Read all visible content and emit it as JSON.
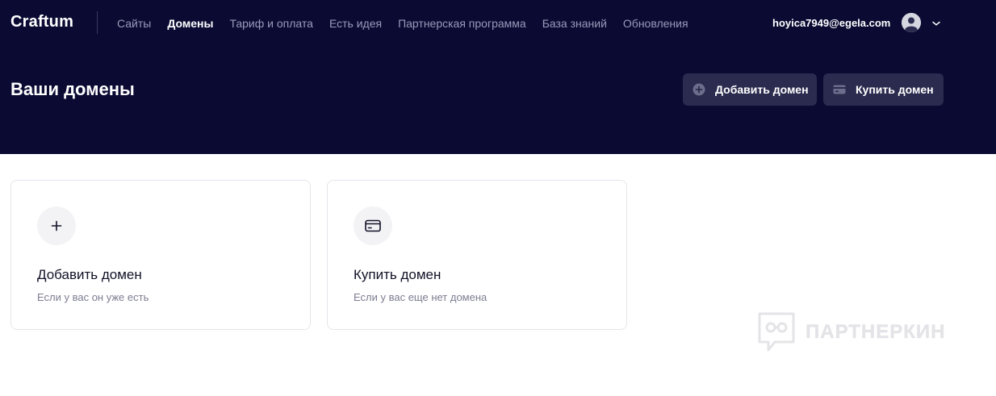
{
  "app": {
    "logo": "Craftum"
  },
  "nav": {
    "items": [
      {
        "label": "Сайты",
        "active": false
      },
      {
        "label": "Домены",
        "active": true
      },
      {
        "label": "Тариф и оплата",
        "active": false
      },
      {
        "label": "Есть идея",
        "active": false
      },
      {
        "label": "Партнерская программа",
        "active": false
      },
      {
        "label": "База знаний",
        "active": false
      },
      {
        "label": "Обновления",
        "active": false
      }
    ]
  },
  "user": {
    "email": "hoyica7949@egela.com",
    "avatar_icon": "user-avatar-icon",
    "menu_icon": "chevron-down-icon"
  },
  "page": {
    "title": "Ваши домены",
    "add_button_label": "Добавить домен",
    "buy_button_label": "Купить домен"
  },
  "cards": {
    "add": {
      "title": "Добавить домен",
      "subtitle": "Если у вас он уже есть",
      "icon": "plus-icon"
    },
    "buy": {
      "title": "Купить домен",
      "subtitle": "Если у вас еще нет домена",
      "icon": "card-icon"
    }
  },
  "watermark": {
    "text": "ПАРТНЕРКИН"
  },
  "colors": {
    "header_bg": "#0a0a33",
    "button_bg": "#2b2b4f",
    "nav_inactive": "#9a9ab8",
    "text_dark": "#111127"
  }
}
